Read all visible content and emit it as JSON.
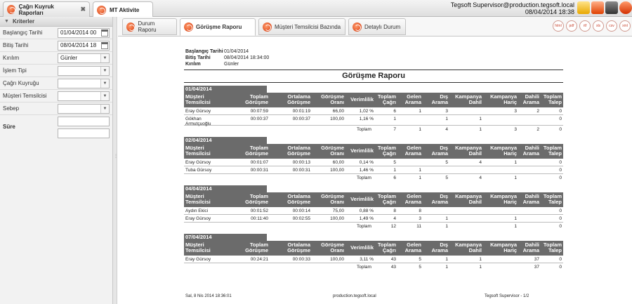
{
  "app_tabs": [
    {
      "label": "Çağrı Kuyruk Raporları",
      "close": "✖"
    },
    {
      "label": "MT Aktivite"
    }
  ],
  "user": {
    "name": "Tegsoft Supervisor@production.tegsoft.local",
    "datetime": "08/04/2014 18:38"
  },
  "criteria": {
    "title": "Kriterler",
    "fields": [
      {
        "label": "Başlangıç Tarihi",
        "value": "01/04/2014 00",
        "type": "date"
      },
      {
        "label": "Bitiş Tarihi",
        "value": "08/04/2014 18",
        "type": "date"
      },
      {
        "label": "Kırılım",
        "value": "Günler",
        "type": "select"
      },
      {
        "label": "İşlem Tipi",
        "value": "",
        "type": "select"
      },
      {
        "label": "Çağrı Kuyruğu",
        "value": "",
        "type": "select"
      },
      {
        "label": "Müşteri Temsilcisi",
        "value": "",
        "type": "select"
      },
      {
        "label": "Sebep",
        "value": "",
        "type": "select"
      }
    ],
    "sure_label": "Süre"
  },
  "sub_tabs": [
    "Durum Raporu",
    "Görüşme Raporu",
    "Müşteri Temsilcisi Bazında",
    "Detaylı Durum"
  ],
  "export_buttons": [
    "html",
    "pdf",
    "rtf",
    "xls",
    "csv",
    "xml"
  ],
  "report": {
    "header": [
      {
        "k": "Başlangıç Tarihi",
        "v": "01/04/2014"
      },
      {
        "k": "Bitiş Tarihi",
        "v": "08/04/2014 18:34:00"
      },
      {
        "k": "Kırılım",
        "v": "Günler"
      }
    ],
    "title": "Görüşme Raporu",
    "columns": [
      "Müşteri Temsilcisi",
      "Toplam Görüşme",
      "Ortalama Görüşme",
      "Görüşme Oranı",
      "Verimlilik",
      "Toplam Çağrı",
      "Gelen Arama",
      "Dış Arama",
      "Kampanya Dahil",
      "Kampanya Hariç",
      "Dahili Arama",
      "Toplam Talep"
    ],
    "total_label": "Toplam",
    "groups": [
      {
        "date": "01/04/2014",
        "rows": [
          [
            "Eray Gürsoy",
            "00:07:59",
            "00:01:19",
            "66,00",
            "1,02 %",
            "6",
            "1",
            "3",
            "",
            "3",
            "2",
            "0"
          ],
          [
            "Gökhan Armutçuoğlu",
            "00:00:37",
            "00:00:37",
            "100,00",
            "1,16 %",
            "1",
            "",
            "1",
            "1",
            "",
            "",
            "0"
          ]
        ],
        "total": [
          "7",
          "1",
          "4",
          "1",
          "3",
          "2",
          "0"
        ]
      },
      {
        "date": "02/04/2014",
        "rows": [
          [
            "Eray Gürsoy",
            "00:01:07",
            "00:00:13",
            "60,00",
            "0,14 %",
            "5",
            "",
            "5",
            "4",
            "1",
            "",
            "0"
          ],
          [
            "Tuba Gürsoy",
            "00:00:31",
            "00:00:31",
            "100,00",
            "1,46 %",
            "1",
            "1",
            "",
            "",
            "",
            "",
            "0"
          ]
        ],
        "total": [
          "6",
          "1",
          "5",
          "4",
          "1",
          "",
          "0"
        ]
      },
      {
        "date": "04/04/2014",
        "rows": [
          [
            "Aydın Ekici",
            "00:01:52",
            "00:00:14",
            "75,00",
            "0,88 %",
            "8",
            "8",
            "",
            "",
            "",
            "",
            "0"
          ],
          [
            "Eray Gürsoy",
            "00:11:40",
            "00:02:55",
            "100,00",
            "1,49 %",
            "4",
            "3",
            "1",
            "",
            "1",
            "",
            "0"
          ]
        ],
        "total": [
          "12",
          "11",
          "1",
          "",
          "1",
          "",
          "0"
        ]
      },
      {
        "date": "07/04/2014",
        "rows": [
          [
            "Eray Gürsoy",
            "00:24:21",
            "00:00:33",
            "100,00",
            "3,11 %",
            "43",
            "5",
            "1",
            "1",
            "",
            "37",
            "0"
          ]
        ],
        "total": [
          "43",
          "5",
          "1",
          "1",
          "",
          "37",
          "0"
        ]
      }
    ],
    "footer": {
      "left": "Sal, 8 Nis 2014 18:36:01",
      "center": "production.tegsoft.local",
      "right": "Tegsoft Supervisor - 1/2"
    }
  },
  "colors": {
    "header_gray": "#6b6b6b",
    "accent_red": "#d32f00",
    "export_red": "#c8442f"
  }
}
